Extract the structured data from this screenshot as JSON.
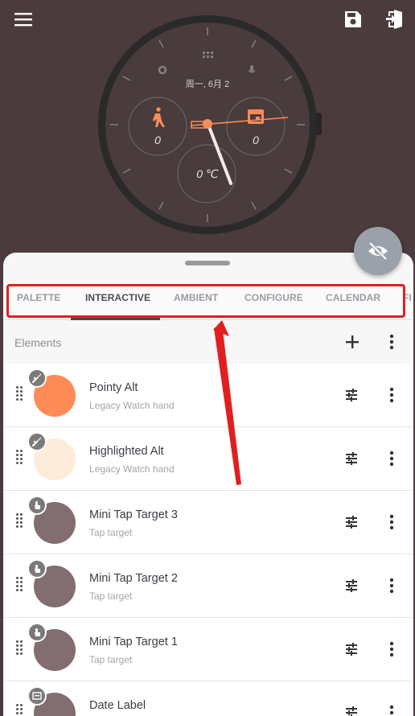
{
  "app": {
    "tabs": [
      "PALETTE",
      "INTERACTIVE",
      "AMBIENT",
      "CONFIGURE",
      "CALENDAR",
      "FI"
    ],
    "active_tab": "INTERACTIVE"
  },
  "watch": {
    "date": "周一, 6月 2",
    "steps": "0",
    "calendar": "0",
    "temperature": "0 ℃"
  },
  "elements": {
    "title": "Elements",
    "items": [
      {
        "title": "Pointy Alt",
        "subtitle": "Legacy Watch hand",
        "color": "#ff8c57",
        "badge": "hand-icon"
      },
      {
        "title": "Highlighted Alt",
        "subtitle": "Legacy Watch hand",
        "color": "#fcecd9",
        "badge": "hand-icon"
      },
      {
        "title": "Mini Tap Target 3",
        "subtitle": "Tap target",
        "color": "#826d70",
        "badge": "touch-icon"
      },
      {
        "title": "Mini Tap Target 2",
        "subtitle": "Tap target",
        "color": "#826d70",
        "badge": "touch-icon"
      },
      {
        "title": "Mini Tap Target 1",
        "subtitle": "Tap target",
        "color": "#826d70",
        "badge": "touch-icon"
      },
      {
        "title": "Date Label",
        "subtitle": "",
        "color": "#826d70",
        "badge": "label-icon"
      }
    ]
  },
  "colors": {
    "background": "#4b3b3c",
    "accent": "#ff8c57",
    "annotation": "#e02020"
  }
}
